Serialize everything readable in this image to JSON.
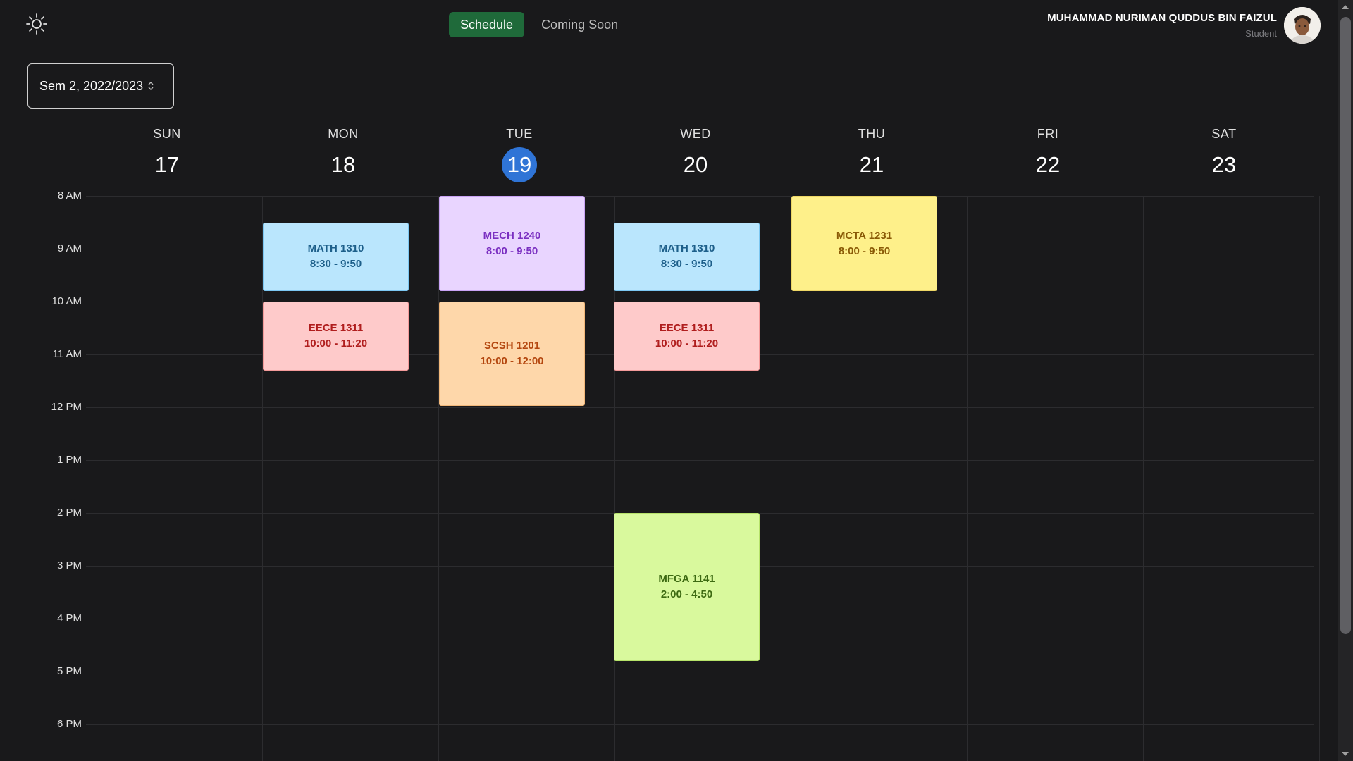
{
  "header": {
    "theme_icon": "sun-icon",
    "nav": [
      {
        "label": "Schedule",
        "active": true
      },
      {
        "label": "Coming Soon",
        "active": false
      }
    ],
    "user": {
      "name": "MUHAMMAD NURIMAN QUDDUS BIN FAIZUL",
      "role": "Student"
    }
  },
  "semester_select": {
    "value": "Sem 2, 2022/2023",
    "icon": "chevron-up-down-icon"
  },
  "calendar": {
    "days": [
      {
        "dow": "SUN",
        "date": "17",
        "today": false
      },
      {
        "dow": "MON",
        "date": "18",
        "today": false
      },
      {
        "dow": "TUE",
        "date": "19",
        "today": true
      },
      {
        "dow": "WED",
        "date": "20",
        "today": false
      },
      {
        "dow": "THU",
        "date": "21",
        "today": false
      },
      {
        "dow": "FRI",
        "date": "22",
        "today": false
      },
      {
        "dow": "SAT",
        "date": "23",
        "today": false
      }
    ],
    "time_labels": [
      "8 AM",
      "9 AM",
      "10 AM",
      "11 AM",
      "12 PM",
      "1 PM",
      "2 PM",
      "3 PM",
      "4 PM",
      "5 PM",
      "6 PM"
    ],
    "events": [
      {
        "day": 1,
        "code": "MATH 1310",
        "time": "8:30 - 9:50",
        "start": 8.5,
        "end": 9.833,
        "color": "blue"
      },
      {
        "day": 1,
        "code": "EECE 1311",
        "time": "10:00 - 11:20",
        "start": 10,
        "end": 11.333,
        "color": "red"
      },
      {
        "day": 2,
        "code": "MECH 1240",
        "time": "8:00 - 9:50",
        "start": 8,
        "end": 9.833,
        "color": "purple"
      },
      {
        "day": 2,
        "code": "SCSH 1201",
        "time": "10:00 - 12:00",
        "start": 10,
        "end": 12,
        "color": "orange"
      },
      {
        "day": 3,
        "code": "MATH 1310",
        "time": "8:30 - 9:50",
        "start": 8.5,
        "end": 9.833,
        "color": "blue"
      },
      {
        "day": 3,
        "code": "EECE 1311",
        "time": "10:00 - 11:20",
        "start": 10,
        "end": 11.333,
        "color": "red"
      },
      {
        "day": 3,
        "code": "MFGA 1141",
        "time": "2:00 - 4:50",
        "start": 14,
        "end": 16.833,
        "color": "green"
      },
      {
        "day": 4,
        "code": "MCTA 1231",
        "time": "8:00 - 9:50",
        "start": 8,
        "end": 9.833,
        "color": "yellow"
      }
    ]
  },
  "colors": {
    "background": "#19191b",
    "active_nav": "#1f6a3a",
    "today_highlight": "#2f74d6"
  }
}
